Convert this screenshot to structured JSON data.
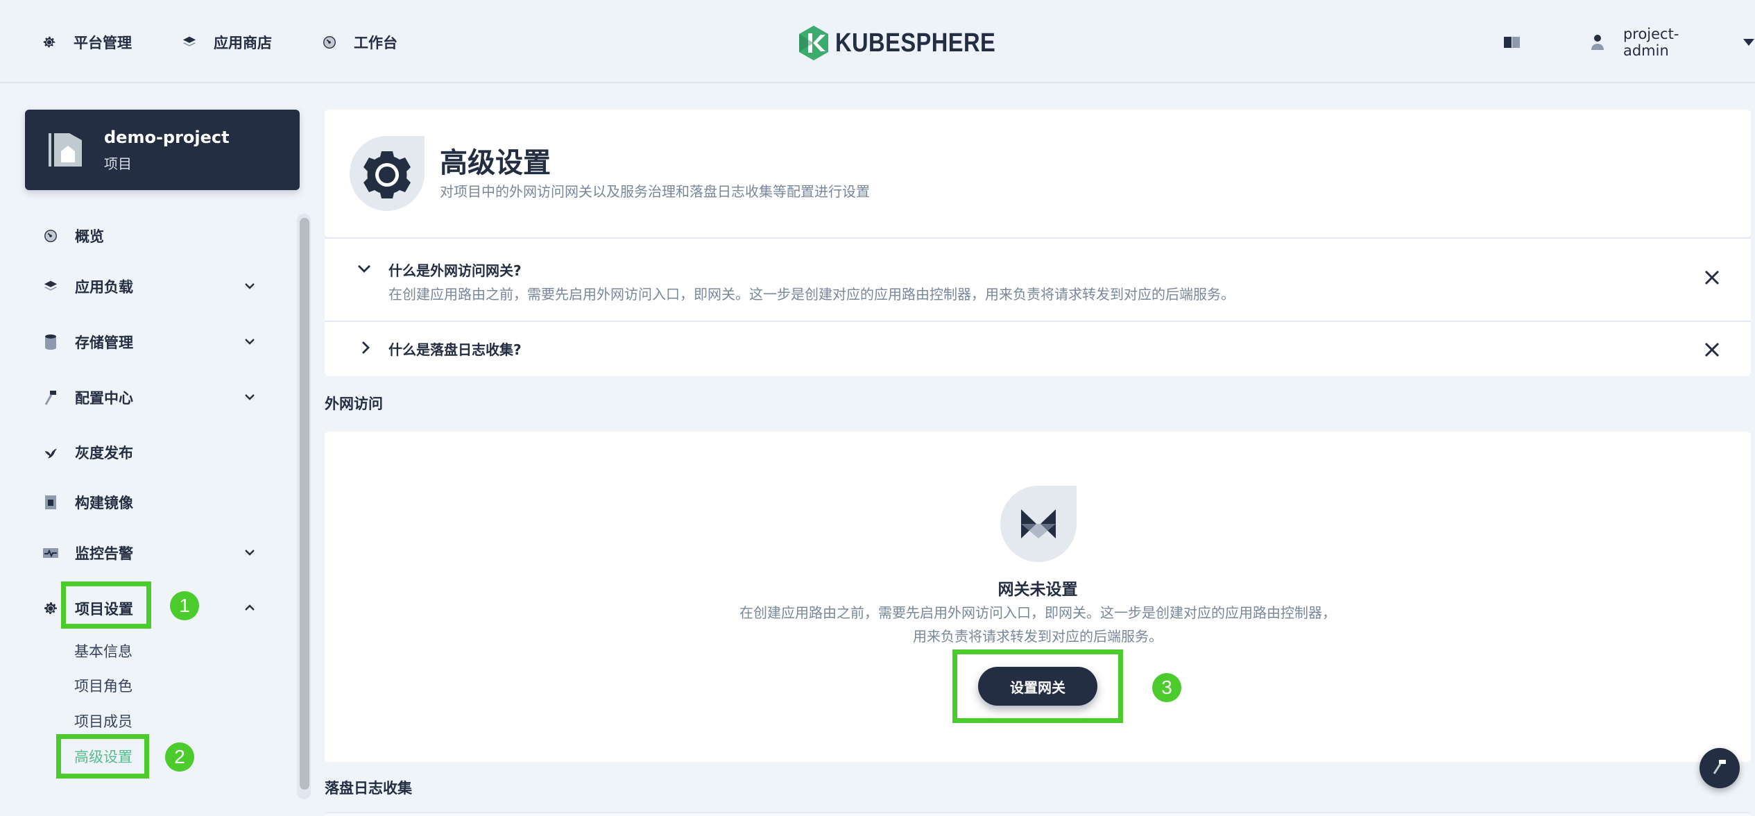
{
  "topnav": {
    "items": [
      {
        "label": "平台管理",
        "icon": "gear-icon"
      },
      {
        "label": "应用商店",
        "icon": "layers-icon"
      },
      {
        "label": "工作台",
        "icon": "dashboard-icon"
      }
    ],
    "brand": "KUBESPHERE",
    "user": "project-admin",
    "brand_color": "#3bab6e"
  },
  "project": {
    "name": "demo-project",
    "type": "项目"
  },
  "sidebar": {
    "items": [
      {
        "label": "概览",
        "icon": "dashboard-icon"
      },
      {
        "label": "应用负载",
        "icon": "layers-icon"
      },
      {
        "label": "存储管理",
        "icon": "database-icon"
      },
      {
        "label": "配置中心",
        "icon": "hammer-icon"
      },
      {
        "label": "灰度发布",
        "icon": "bird-icon"
      },
      {
        "label": "构建镜像",
        "icon": "image-builder-icon"
      },
      {
        "label": "监控告警",
        "icon": "monitor-icon"
      },
      {
        "label": "项目设置",
        "icon": "gear-icon"
      }
    ],
    "sub_items": [
      {
        "label": "基本信息"
      },
      {
        "label": "项目角色"
      },
      {
        "label": "项目成员"
      },
      {
        "label": "高级设置"
      }
    ],
    "active_color": "#55bc8a"
  },
  "annotations": {
    "badge1": "1",
    "badge2": "2",
    "badge3": "3",
    "color": "#4ccb2c"
  },
  "header": {
    "title": "高级设置",
    "description": "对项目中的外网访问网关以及服务治理和落盘日志收集等配置进行设置"
  },
  "tips": [
    {
      "title": "什么是外网访问网关?",
      "text": "在创建应用路由之前，需要先启用外网访问入口，即网关。这一步是创建对应的应用路由控制器，用来负责将请求转发到对应的后端服务。"
    },
    {
      "title": "什么是落盘日志收集?"
    }
  ],
  "gateway": {
    "section_label": "外网访问",
    "empty_title": "网关未设置",
    "empty_desc_line1": "在创建应用路由之前，需要先启用外网访问入口，即网关。这一步是创建对应的应用路由控制器，",
    "empty_desc_line2": "用来负责将请求转发到对应的后端服务。",
    "button": "设置网关"
  },
  "log_collection": {
    "section_label": "落盘日志收集"
  }
}
